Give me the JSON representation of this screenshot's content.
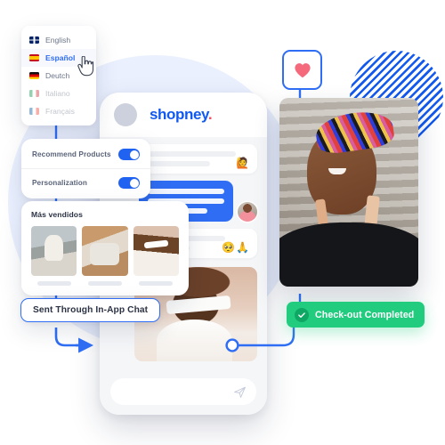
{
  "decor": {
    "hatch_circle": "blue-striped-circle",
    "bg_circle_color": "#eaf0fe",
    "accent_blue": "#2f6ef4",
    "brand_blue": "#1159f0",
    "brand_dot_red": "#fb4d61",
    "success_green": "#22cc7f"
  },
  "language_menu": {
    "name": "language-selector",
    "items": [
      {
        "label": "English",
        "flag": "flag-uk",
        "selected": false,
        "disabled": false
      },
      {
        "label": "Español",
        "flag": "flag-spain",
        "selected": true,
        "disabled": false
      },
      {
        "label": "Deutch",
        "flag": "flag-germany",
        "selected": false,
        "disabled": false
      },
      {
        "label": "Italiano",
        "flag": "flag-italy",
        "selected": false,
        "disabled": true
      },
      {
        "label": "Français",
        "flag": "flag-france",
        "selected": false,
        "disabled": true
      }
    ],
    "cursor_icon": "pointer-hand-cursor"
  },
  "settings_card": {
    "name": "settings-toggles",
    "rows": [
      {
        "label": "Recommend Products",
        "state": "on"
      },
      {
        "label": "Personalization",
        "state": "on"
      }
    ]
  },
  "best_sellers": {
    "title": "Más vendidos",
    "products": [
      {
        "name": "product-thumb-1"
      },
      {
        "name": "product-thumb-2"
      },
      {
        "name": "product-thumb-3"
      }
    ]
  },
  "chat_pill": {
    "label": "Sent Through In-App Chat"
  },
  "heart_node": {
    "icon": "heart-icon"
  },
  "phone": {
    "brand": "shopney",
    "brand_dot": ".",
    "avatar": "store-avatar",
    "messages": [
      {
        "type": "incoming",
        "emoji": "🙋"
      },
      {
        "type": "outgoing",
        "avatar": "customer-avatar"
      },
      {
        "type": "incoming",
        "emoji": "🥺🙏"
      },
      {
        "type": "photo",
        "name": "product-photo-message"
      }
    ],
    "composer": {
      "placeholder": "",
      "send_icon": "send-paper-plane-icon"
    }
  },
  "hero_photo": {
    "name": "smiling-woman-photo"
  },
  "status_badge": {
    "label": "Check-out Completed",
    "icon": "check-circle-icon"
  }
}
